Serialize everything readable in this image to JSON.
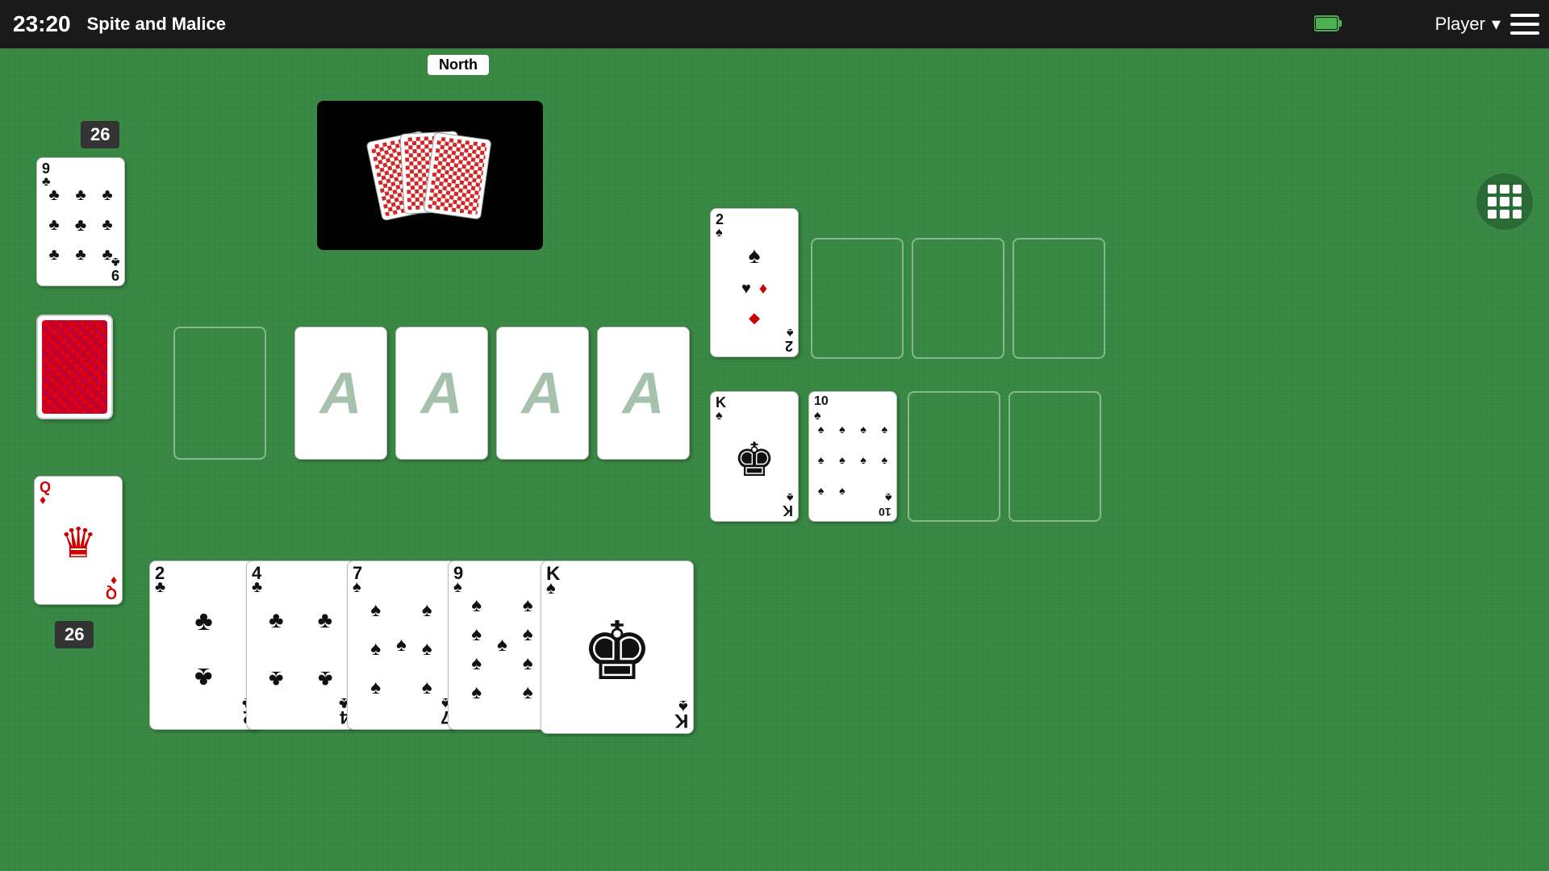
{
  "topbar": {
    "time": "23:20",
    "app_title": "Spite and Malice",
    "player_label": "Player",
    "player_arrow": "▾"
  },
  "north_player": {
    "label": "North",
    "card_count": 26,
    "hand_cards": 3
  },
  "south_player": {
    "label": "Player",
    "card_count": 26
  },
  "game": {
    "center_piles": [
      "A",
      "A",
      "A",
      "A"
    ],
    "opponent_stock_card": {
      "rank": "2",
      "suit": "♠",
      "suit_bottom": [
        "♥",
        "♦",
        "◆"
      ],
      "color": "black"
    },
    "opponent_discard1": {
      "rank": "K",
      "suit": "♠",
      "color": "black",
      "face": "king"
    },
    "opponent_discard2": {
      "rank": "10",
      "suit": "♠",
      "color": "black"
    },
    "player_stock_top": {
      "rank": "Q",
      "suit": "♦",
      "color": "red",
      "face": "queen"
    },
    "player_hand": [
      {
        "rank": "2",
        "suit": "♣",
        "color": "black"
      },
      {
        "rank": "4",
        "suit": "♣",
        "color": "black"
      },
      {
        "rank": "7",
        "suit": "♠",
        "color": "black"
      },
      {
        "rank": "9",
        "suit": "♠",
        "color": "black"
      },
      {
        "rank": "K",
        "suit": "♠",
        "color": "black",
        "face": "king"
      }
    ]
  }
}
